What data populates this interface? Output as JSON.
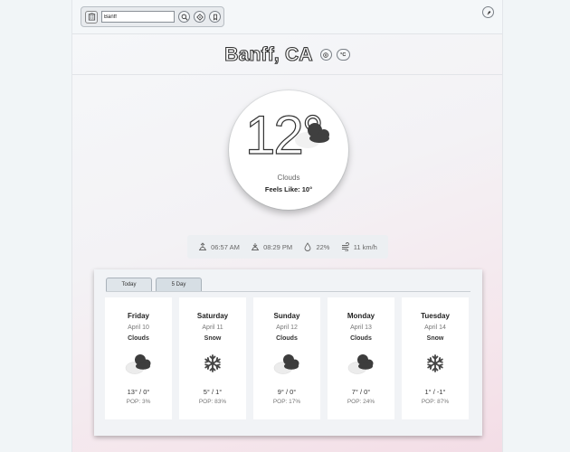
{
  "search": {
    "value": "Banff",
    "home_icon": "building-icon",
    "search_icon": "search-icon",
    "location_icon": "location-diamond-icon",
    "bookmark_icon": "bookmark-icon"
  },
  "top_right_icon": "badge-icon",
  "city": {
    "name": "Banff, CA",
    "actions": [
      "compass-icon",
      "unit-toggle-icon"
    ],
    "unit_label": "°C"
  },
  "current": {
    "temp": "12°",
    "condition": "Clouds",
    "feels_label": "Feels Like:",
    "feels_value": "10°"
  },
  "stats": {
    "sunrise": "06:57 AM",
    "sunset": "08:29 PM",
    "humidity": "22%",
    "wind": "11 km/h"
  },
  "tabs": [
    {
      "label": "Today"
    },
    {
      "label": "5 Day"
    }
  ],
  "forecast": [
    {
      "day": "Friday",
      "date": "April 10",
      "condition": "Clouds",
      "icon": "clouds",
      "temps": "13° / 0°",
      "pop": "POP: 3%"
    },
    {
      "day": "Saturday",
      "date": "April 11",
      "condition": "Snow",
      "icon": "snow",
      "temps": "5° / 1°",
      "pop": "POP: 83%"
    },
    {
      "day": "Sunday",
      "date": "April 12",
      "condition": "Clouds",
      "icon": "clouds",
      "temps": "9° / 0°",
      "pop": "POP: 17%"
    },
    {
      "day": "Monday",
      "date": "April 13",
      "condition": "Clouds",
      "icon": "clouds",
      "temps": "7° / 0°",
      "pop": "POP: 24%"
    },
    {
      "day": "Tuesday",
      "date": "April 14",
      "condition": "Snow",
      "icon": "snow",
      "temps": "1° / -1°",
      "pop": "POP: 87%"
    }
  ]
}
